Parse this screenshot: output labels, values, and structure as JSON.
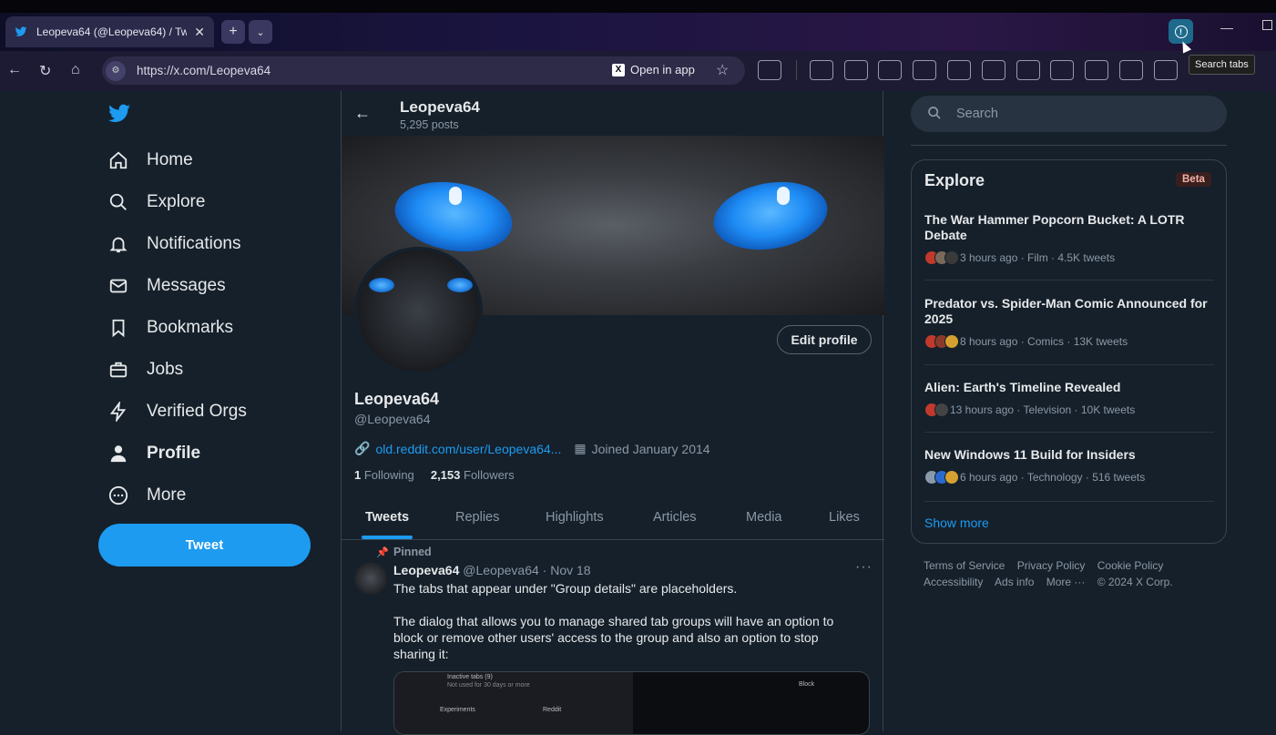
{
  "browser": {
    "tab_title": "Leopeva64 (@Leopeva64) / Tw",
    "url": "https://x.com/Leopeva64",
    "open_in_app": "Open in app",
    "tooltip": "Search tabs"
  },
  "sidebar": {
    "items": [
      {
        "label": "Home",
        "icon": "home-icon"
      },
      {
        "label": "Explore",
        "icon": "search-icon"
      },
      {
        "label": "Notifications",
        "icon": "bell-icon"
      },
      {
        "label": "Messages",
        "icon": "mail-icon"
      },
      {
        "label": "Bookmarks",
        "icon": "bookmark-icon"
      },
      {
        "label": "Jobs",
        "icon": "briefcase-icon"
      },
      {
        "label": "Verified Orgs",
        "icon": "lightning-icon"
      },
      {
        "label": "Profile",
        "icon": "person-icon"
      },
      {
        "label": "More",
        "icon": "more-circle-icon"
      }
    ],
    "tweet_label": "Tweet"
  },
  "profile": {
    "header_name": "Leopeva64",
    "post_count": "5,295 posts",
    "edit_label": "Edit profile",
    "name": "Leopeva64",
    "handle": "@Leopeva64",
    "link": "old.reddit.com/user/Leopeva64...",
    "joined": "Joined January 2014",
    "following_count": "1",
    "following_label": "Following",
    "followers_count": "2,153",
    "followers_label": "Followers",
    "tabs": [
      "Tweets",
      "Replies",
      "Highlights",
      "Articles",
      "Media",
      "Likes"
    ]
  },
  "tweet": {
    "pinned_label": "Pinned",
    "author": "Leopeva64",
    "handle_date": "@Leopeva64 · Nov 18",
    "line1": "The tabs that appear under \"Group details\" are placeholders.",
    "line2": "The dialog that allows you to manage shared tab groups will have an option to block or remove other users' access to the group and also an option to stop sharing it:",
    "media_rows": [
      "Inactive tabs (9)",
      "Not used for 30 days or more",
      "Experiments",
      "Reddit",
      "Block"
    ]
  },
  "right": {
    "search_placeholder": "Search",
    "explore_title": "Explore",
    "beta": "Beta",
    "trends": [
      {
        "headline": "The War Hammer Popcorn Bucket: A LOTR Debate",
        "meta": "3 hours ago · Film · 4.5K tweets"
      },
      {
        "headline": "Predator vs. Spider-Man Comic Announced for 2025",
        "meta": "8 hours ago · Comics · 13K tweets"
      },
      {
        "headline": "Alien: Earth's Timeline Revealed",
        "meta": "13 hours ago · Television · 10K tweets"
      },
      {
        "headline": "New Windows 11 Build for Insiders",
        "meta": "6 hours ago · Technology · 516 tweets"
      }
    ],
    "show_more": "Show more",
    "footer": [
      "Terms of Service",
      "Privacy Policy",
      "Cookie Policy",
      "Accessibility",
      "Ads info",
      "More ···",
      "© 2024 X Corp."
    ]
  },
  "colors": {
    "accent": "#1d9bf0",
    "background": "#15202b",
    "border": "#38444d",
    "muted": "#8b98a5"
  }
}
